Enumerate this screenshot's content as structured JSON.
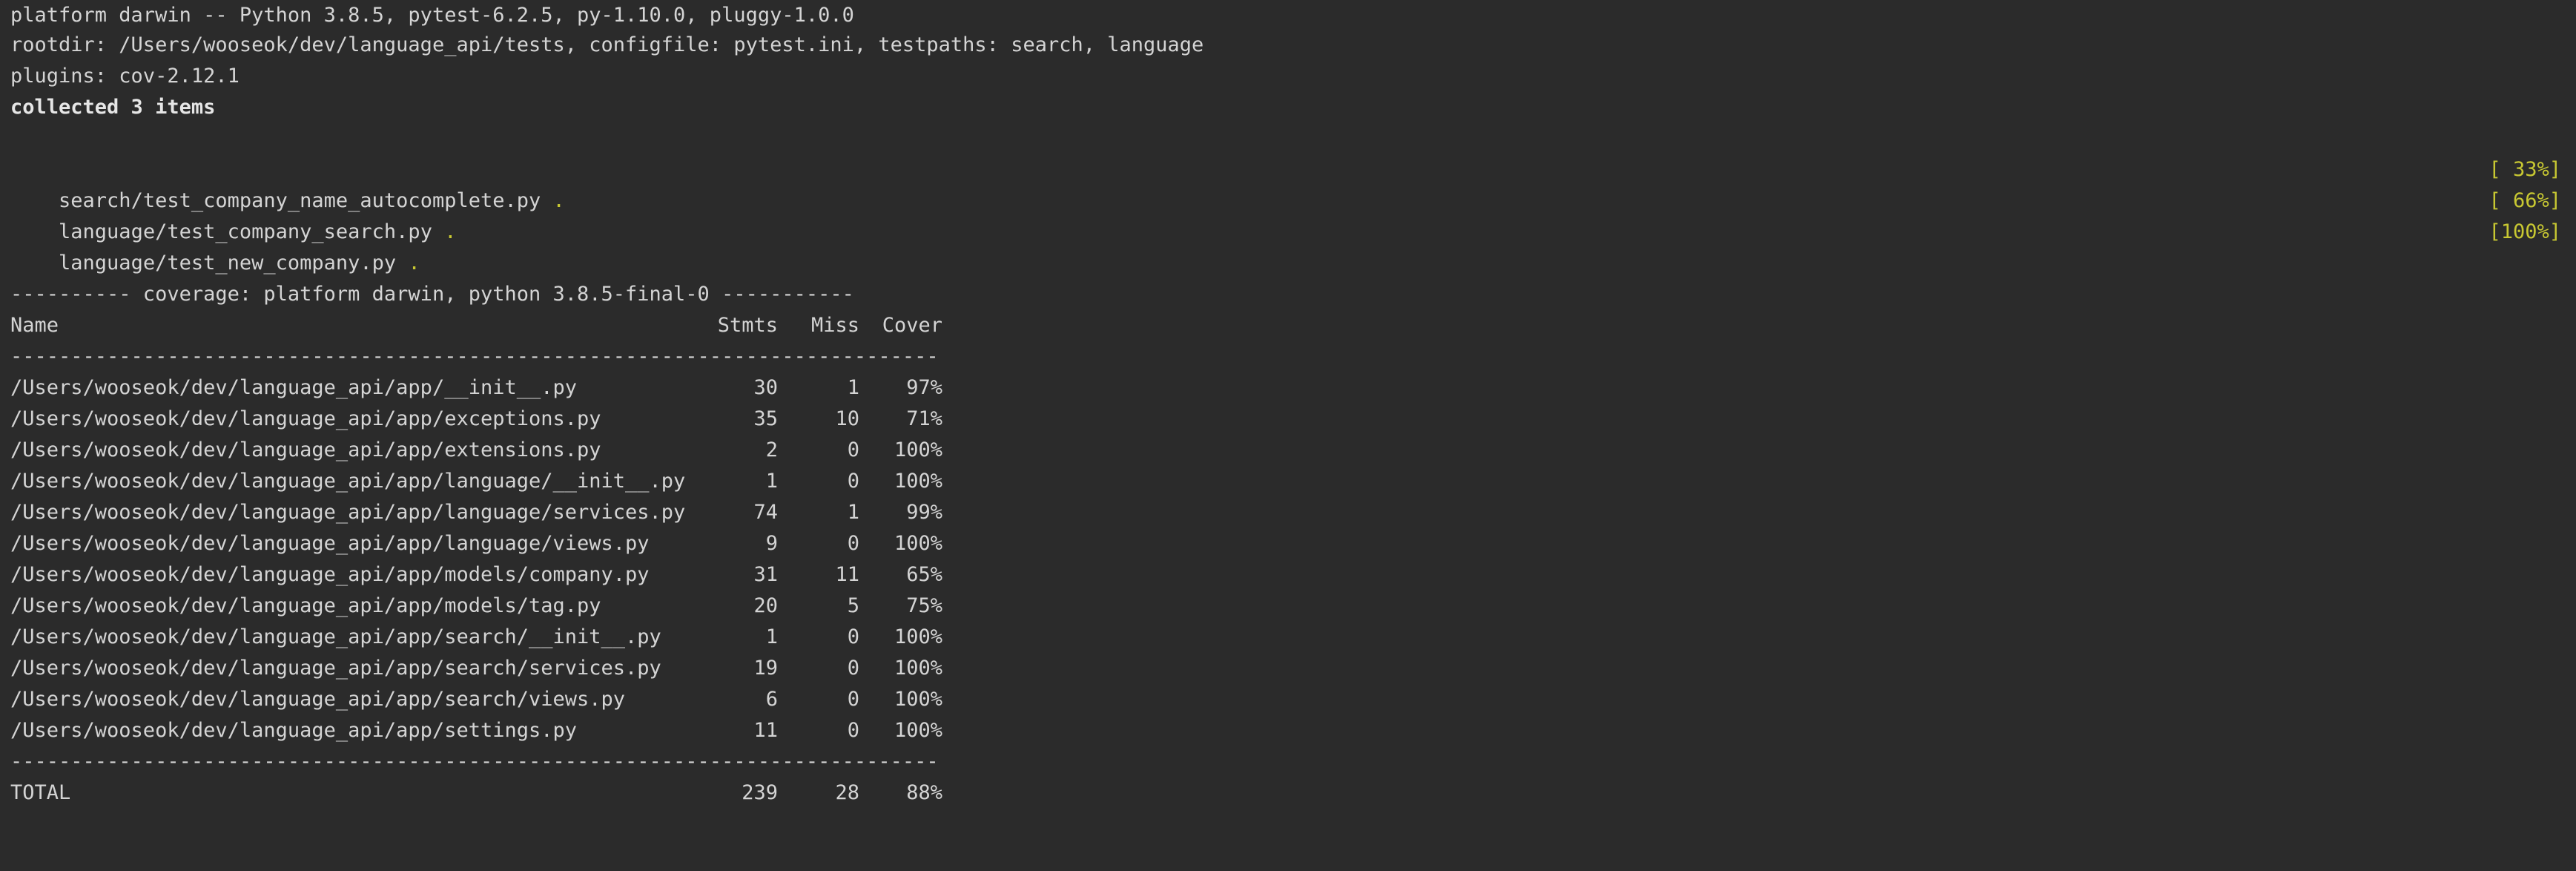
{
  "header": {
    "platform": "platform darwin -- Python 3.8.5, pytest-6.2.5, py-1.10.0, pluggy-1.0.0",
    "rootdir": "rootdir: /Users/wooseok/dev/language_api/tests, configfile: pytest.ini, testpaths: search, language",
    "plugins": "plugins: cov-2.12.1",
    "collected": "collected 3 items"
  },
  "tests": [
    {
      "file": "search/test_company_name_autocomplete.py",
      "result": ".",
      "progress": "[ 33%]"
    },
    {
      "file": "language/test_company_search.py",
      "result": ".",
      "progress": "[ 66%]"
    },
    {
      "file": "language/test_new_company.py",
      "result": ".",
      "progress": "[100%]"
    }
  ],
  "coverage": {
    "title": "---------- coverage: platform darwin, python 3.8.5-final-0 -----------",
    "columns": {
      "name": "Name",
      "stmts": "Stmts",
      "miss": "Miss",
      "cover": "Cover"
    },
    "separator": "-----------------------------------------------------------------------------",
    "rows": [
      {
        "name": "/Users/wooseok/dev/language_api/app/__init__.py",
        "stmts": "30",
        "miss": "1",
        "cover": "97%"
      },
      {
        "name": "/Users/wooseok/dev/language_api/app/exceptions.py",
        "stmts": "35",
        "miss": "10",
        "cover": "71%"
      },
      {
        "name": "/Users/wooseok/dev/language_api/app/extensions.py",
        "stmts": "2",
        "miss": "0",
        "cover": "100%"
      },
      {
        "name": "/Users/wooseok/dev/language_api/app/language/__init__.py",
        "stmts": "1",
        "miss": "0",
        "cover": "100%"
      },
      {
        "name": "/Users/wooseok/dev/language_api/app/language/services.py",
        "stmts": "74",
        "miss": "1",
        "cover": "99%"
      },
      {
        "name": "/Users/wooseok/dev/language_api/app/language/views.py",
        "stmts": "9",
        "miss": "0",
        "cover": "100%"
      },
      {
        "name": "/Users/wooseok/dev/language_api/app/models/company.py",
        "stmts": "31",
        "miss": "11",
        "cover": "65%"
      },
      {
        "name": "/Users/wooseok/dev/language_api/app/models/tag.py",
        "stmts": "20",
        "miss": "5",
        "cover": "75%"
      },
      {
        "name": "/Users/wooseok/dev/language_api/app/search/__init__.py",
        "stmts": "1",
        "miss": "0",
        "cover": "100%"
      },
      {
        "name": "/Users/wooseok/dev/language_api/app/search/services.py",
        "stmts": "19",
        "miss": "0",
        "cover": "100%"
      },
      {
        "name": "/Users/wooseok/dev/language_api/app/search/views.py",
        "stmts": "6",
        "miss": "0",
        "cover": "100%"
      },
      {
        "name": "/Users/wooseok/dev/language_api/app/settings.py",
        "stmts": "11",
        "miss": "0",
        "cover": "100%"
      }
    ],
    "total": {
      "name": "TOTAL",
      "stmts": "239",
      "miss": "28",
      "cover": "88%"
    }
  },
  "colors": {
    "background": "#2b2b2b",
    "text": "#d4d4d4",
    "pass": "#c8c832"
  }
}
